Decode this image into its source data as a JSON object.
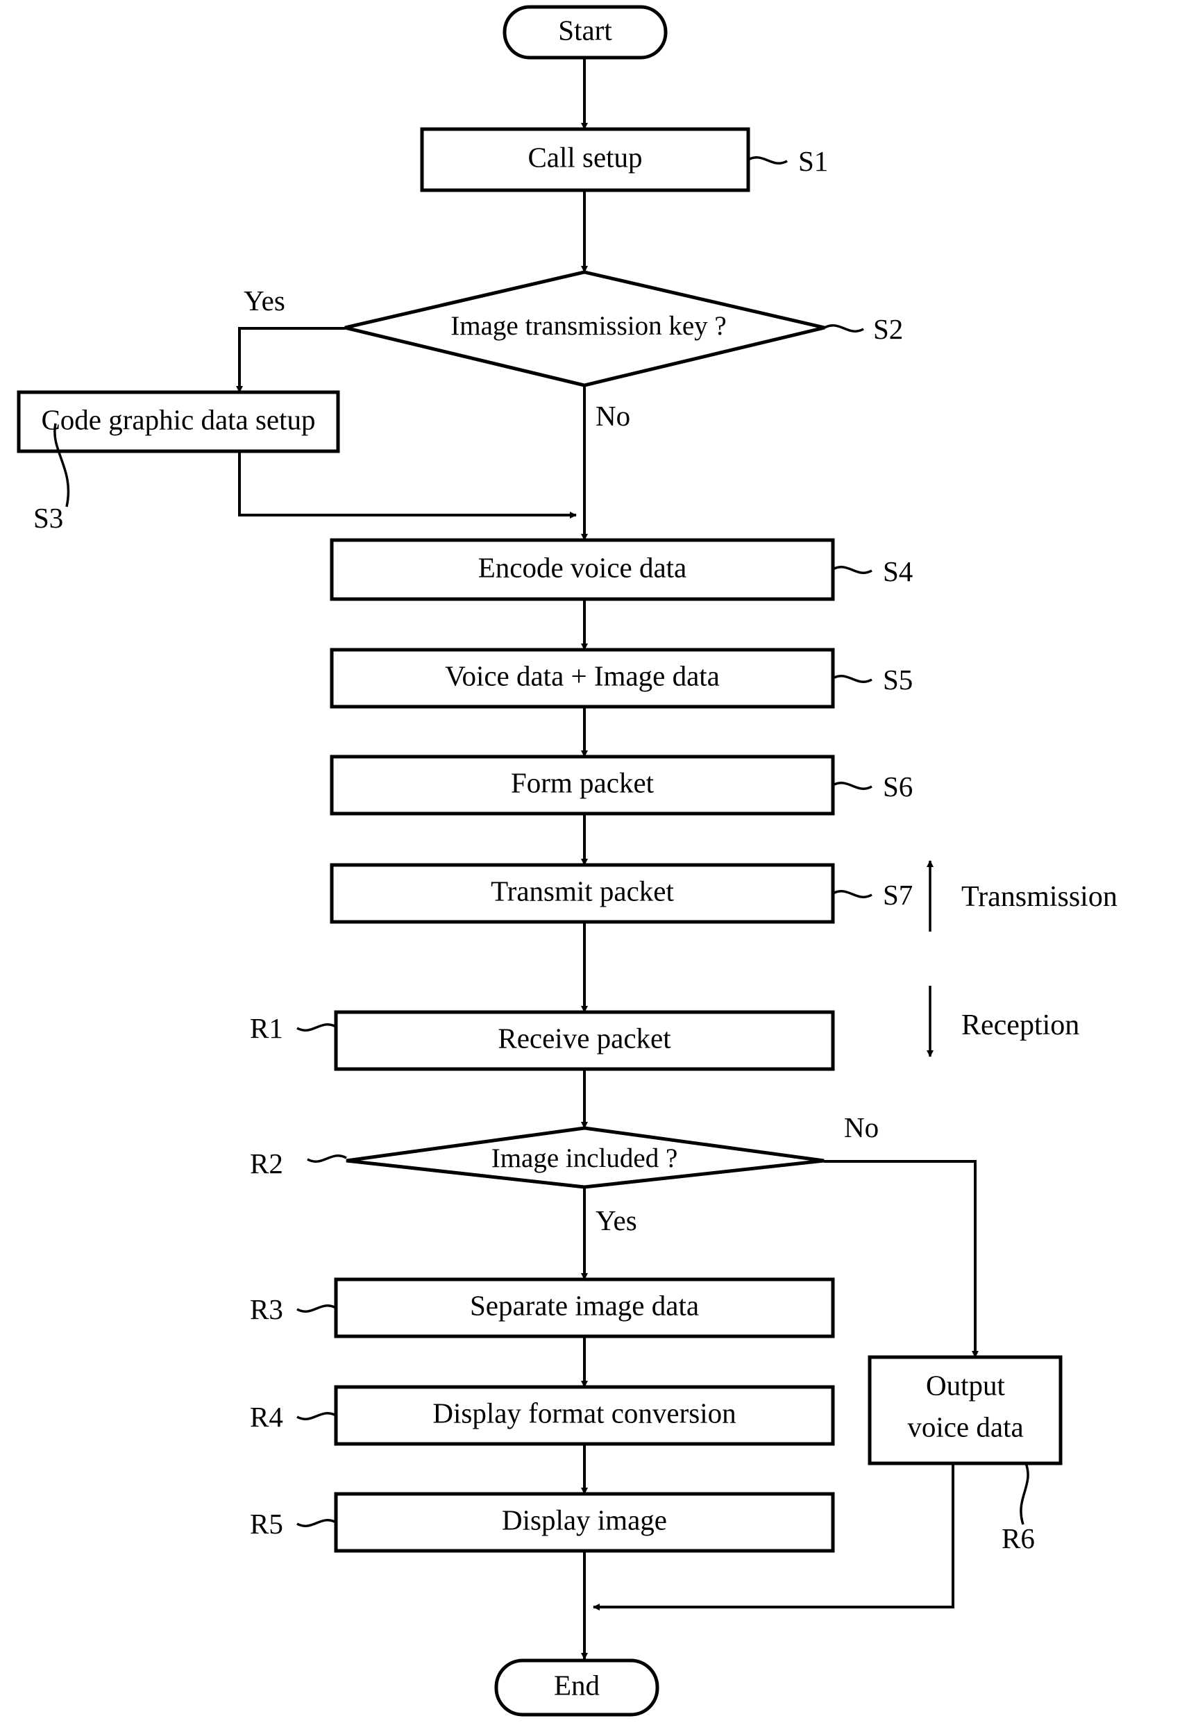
{
  "diagram": {
    "title": "Image transmission and reception flowchart",
    "stroke_color": "#000000",
    "background_color": "#ffffff",
    "nodes": {
      "start": {
        "label": "Start",
        "shape": "terminator"
      },
      "s1": {
        "label": "Call setup",
        "shape": "process",
        "tag": "S1"
      },
      "s2": {
        "label": "Image transmission key ?",
        "shape": "decision",
        "tag": "S2"
      },
      "s3": {
        "label": "Code graphic data setup",
        "shape": "process",
        "tag": "S3"
      },
      "s4": {
        "label": "Encode voice data",
        "shape": "process",
        "tag": "S4"
      },
      "s5": {
        "label": "Voice data + Image data",
        "shape": "process",
        "tag": "S5"
      },
      "s6": {
        "label": "Form packet",
        "shape": "process",
        "tag": "S6"
      },
      "s7": {
        "label": "Transmit packet",
        "shape": "process",
        "tag": "S7"
      },
      "r1": {
        "label": "Receive packet",
        "shape": "process",
        "tag": "R1"
      },
      "r2": {
        "label": "Image included ?",
        "shape": "decision",
        "tag": "R2"
      },
      "r3": {
        "label": "Separate image data",
        "shape": "process",
        "tag": "R3"
      },
      "r4": {
        "label": "Display format conversion",
        "shape": "process",
        "tag": "R4"
      },
      "r5": {
        "label": "Display image",
        "shape": "process",
        "tag": "R5"
      },
      "r6": {
        "label_line1": "Output",
        "label_line2": "voice data",
        "shape": "process",
        "tag": "R6"
      },
      "end": {
        "label": "End",
        "shape": "terminator"
      }
    },
    "branch_labels": {
      "s2_yes": "Yes",
      "s2_no": "No",
      "r2_yes": "Yes",
      "r2_no": "No"
    },
    "phase_labels": {
      "transmission": "Transmission",
      "reception": "Reception"
    }
  }
}
